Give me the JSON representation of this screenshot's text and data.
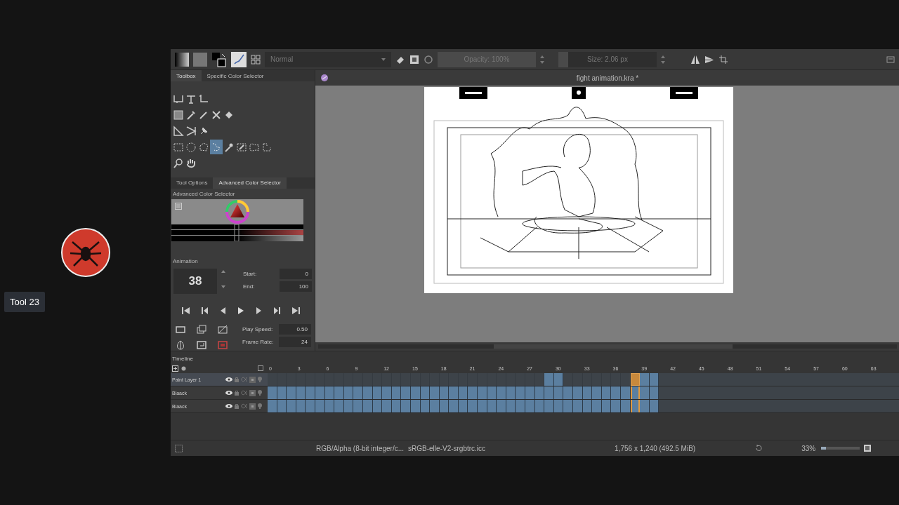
{
  "stream": {
    "caption": "Tool 23"
  },
  "toolbar": {
    "blend_mode": "Normal",
    "opacity": {
      "text": "Opacity: 100%",
      "level": 1
    },
    "size": {
      "text": "Size: 2.06 px",
      "level": 0.1
    }
  },
  "dock_tabs": [
    {
      "label": "Toolbox",
      "selected": true
    },
    {
      "label": "Specific Color Selector",
      "selected": false
    }
  ],
  "toolbox": {
    "rows": [
      [
        {
          "kind": "transform",
          "selected": false
        },
        {
          "kind": "move",
          "selected": false
        },
        {
          "kind": "crop",
          "selected": false
        }
      ],
      [
        {
          "kind": "gradient",
          "selected": false
        },
        {
          "kind": "picker",
          "selected": false
        },
        {
          "kind": "brush",
          "selected": false
        },
        {
          "kind": "multibrush",
          "selected": false
        },
        {
          "kind": "fill",
          "selected": false
        }
      ],
      [
        {
          "kind": "measure",
          "selected": false
        },
        {
          "kind": "assistant",
          "selected": false
        },
        {
          "kind": "pin",
          "selected": false
        }
      ],
      [
        {
          "kind": "rect-select",
          "selected": false
        },
        {
          "kind": "ellipse-select",
          "selected": false
        },
        {
          "kind": "polygon-select",
          "selected": false
        },
        {
          "kind": "freehand-select",
          "selected": true
        },
        {
          "kind": "wand-select",
          "selected": false
        },
        {
          "kind": "similar-select",
          "selected": false
        },
        {
          "kind": "bezier-select",
          "selected": false
        },
        {
          "kind": "path-select",
          "selected": false
        }
      ],
      [
        {
          "kind": "zoom",
          "selected": false
        },
        {
          "kind": "pan",
          "selected": false
        }
      ]
    ]
  },
  "color_tabs": [
    {
      "label": "Tool Options",
      "selected": false
    },
    {
      "label": "Advanced Color Selector",
      "selected": true
    }
  ],
  "color_panel": {
    "title": "Advanced Color Selector"
  },
  "animation": {
    "title": "Animation",
    "frame": "38",
    "range": [
      {
        "label": "Start:",
        "value": "0"
      },
      {
        "label": "End:",
        "value": "100"
      }
    ],
    "playback": [
      {
        "label": "Play Speed:",
        "value": "0.50"
      },
      {
        "label": "Frame Rate:",
        "value": "24"
      }
    ]
  },
  "canvas": {
    "title": "fight animation.kra *"
  },
  "timeline": {
    "title": "Timeline",
    "ruler": [
      "0",
      "3",
      "6",
      "9",
      "12",
      "15",
      "18",
      "21",
      "24",
      "27",
      "30",
      "33",
      "36",
      "39",
      "42",
      "45",
      "48",
      "51",
      "54",
      "57",
      "60",
      "63"
    ],
    "layers": [
      {
        "name": "Paint Layer 1",
        "selected": true,
        "filled": [
          false,
          false,
          false,
          false,
          false,
          false,
          false,
          false,
          false,
          false,
          false,
          false,
          false,
          false,
          false,
          false,
          false,
          false,
          false,
          false,
          false,
          false,
          false,
          false,
          false,
          false,
          false,
          false,
          false,
          true,
          true,
          false,
          false,
          false,
          false,
          false,
          false,
          false,
          true,
          true,
          true
        ],
        "current": [
          false,
          false,
          false,
          false,
          false,
          false,
          false,
          false,
          false,
          false,
          false,
          false,
          false,
          false,
          false,
          false,
          false,
          false,
          false,
          false,
          false,
          false,
          false,
          false,
          false,
          false,
          false,
          false,
          false,
          false,
          false,
          false,
          false,
          false,
          false,
          false,
          false,
          false,
          true,
          false,
          false
        ]
      },
      {
        "name": "Blaack",
        "selected": false,
        "filled": [
          true,
          true,
          true,
          true,
          true,
          true,
          true,
          true,
          true,
          true,
          true,
          true,
          true,
          true,
          true,
          true,
          true,
          true,
          true,
          true,
          true,
          true,
          true,
          true,
          true,
          true,
          true,
          true,
          true,
          true,
          true,
          true,
          true,
          true,
          true,
          true,
          true,
          true,
          true,
          true,
          true
        ],
        "current": [
          false,
          false,
          false,
          false,
          false,
          false,
          false,
          false,
          false,
          false,
          false,
          false,
          false,
          false,
          false,
          false,
          false,
          false,
          false,
          false,
          false,
          false,
          false,
          false,
          false,
          false,
          false,
          false,
          false,
          false,
          false,
          false,
          false,
          false,
          false,
          false,
          false,
          false,
          true,
          false,
          false
        ]
      },
      {
        "name": "Blaack",
        "selected": false,
        "filled": [
          true,
          true,
          true,
          true,
          true,
          true,
          true,
          true,
          true,
          true,
          true,
          true,
          true,
          true,
          true,
          true,
          true,
          true,
          true,
          true,
          true,
          true,
          true,
          true,
          true,
          true,
          true,
          true,
          true,
          true,
          true,
          true,
          true,
          true,
          true,
          true,
          true,
          true,
          true,
          true,
          true
        ],
        "current": [
          false,
          false,
          false,
          false,
          false,
          false,
          false,
          false,
          false,
          false,
          false,
          false,
          false,
          false,
          false,
          false,
          false,
          false,
          false,
          false,
          false,
          false,
          false,
          false,
          false,
          false,
          false,
          false,
          false,
          false,
          false,
          false,
          false,
          false,
          false,
          false,
          false,
          false,
          true,
          false,
          false
        ]
      }
    ]
  },
  "status_bar": {
    "color_model": "RGB/Alpha (8-bit integer/c...",
    "profile": "sRGB-elle-V2-srgbtrc.icc",
    "dimensions": "1,756 x 1,240 (492.5 MiB)",
    "zoom": "33%",
    "zoom_slider": {
      "level": 0.12
    }
  }
}
